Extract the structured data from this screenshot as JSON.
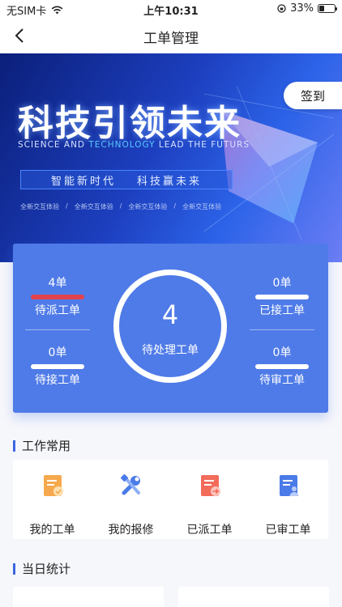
{
  "status_bar": {
    "carrier": "无SIM卡",
    "time": "上午10:31",
    "battery": "33%",
    "battery_level": 0.33
  },
  "nav": {
    "title": "工单管理"
  },
  "banner": {
    "title": "科技引领未来",
    "sub_pre": "SCIENCE  AND  ",
    "sub_hl": "TECHNOLOGY",
    "sub_post": "  LEAD  THE FUTURS",
    "slogan_left": "智能新时代",
    "slogan_right": "科技赢未来",
    "tags": [
      "全新交互体验",
      "/",
      "全新交互体验",
      "/",
      "全新交互体验",
      "/",
      "全新交互体验"
    ],
    "checkin": "签到"
  },
  "stats": {
    "pending_dispatch": {
      "count": "4单",
      "label": "待派工单"
    },
    "pending_accept": {
      "count": "0单",
      "label": "待接工单"
    },
    "accepted": {
      "count": "0单",
      "label": "已接工单"
    },
    "pending_review": {
      "count": "0单",
      "label": "待审工单"
    },
    "center": {
      "count": "4",
      "label": "待处理工单"
    }
  },
  "work": {
    "title": "工作常用",
    "items": [
      {
        "label": "我的工单",
        "icon": "my-order-icon"
      },
      {
        "label": "我的报修",
        "icon": "repair-tools-icon"
      },
      {
        "label": "已派工单",
        "icon": "dispatched-order-icon"
      },
      {
        "label": "已审工单",
        "icon": "reviewed-order-icon"
      }
    ]
  },
  "daily": {
    "title": "当日统计"
  },
  "colors": {
    "primary": "#4f7be8",
    "accent_red": "#e0434d",
    "icon_orange": "#f6a94c",
    "icon_blue": "#4b7be8",
    "icon_red": "#f26b5b"
  }
}
